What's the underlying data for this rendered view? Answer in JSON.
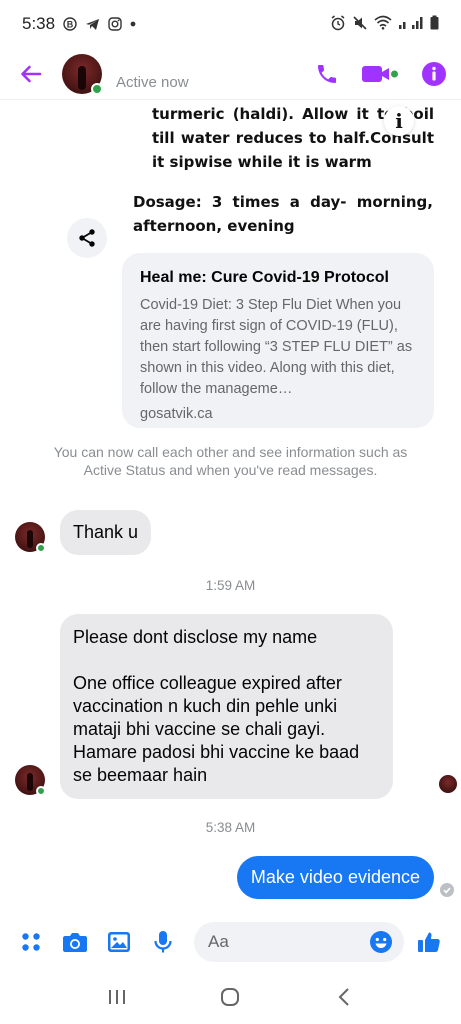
{
  "status_bar": {
    "time": "5:38",
    "left_icons": [
      "b-circle-icon",
      "telegram-icon",
      "instagram-icon",
      "dot-icon"
    ],
    "right_icons": [
      "alarm-icon",
      "mute-icon",
      "wifi-icon",
      "signal-icon",
      "battery-icon"
    ]
  },
  "header": {
    "status": "Active now",
    "accent_color": "#a033ff",
    "icons": [
      "back-arrow-icon",
      "phone-icon",
      "video-icon",
      "info-icon"
    ]
  },
  "thread": {
    "forwarded_text": "turmeric (haldi). Allow it to boil till water reduces to half.Consult it sipwise while it is warm",
    "dosage_text": "Dosage: 3 times a day- morning, afternoon, evening",
    "link_card": {
      "title": "Heal me: Cure Covid-19 Protocol",
      "description": "Covid-19 Diet: 3 Step Flu Diet When you are having first sign of COVID-19 (FLU), then start following “3 STEP FLU DIET” as shown in this video. Along with this diet, follow the manageme…",
      "domain": "gosatvik.ca"
    },
    "system_note": "You can now call each other and see information such as Active Status and when you've read messages.",
    "messages": [
      {
        "direction": "in",
        "text": "Thank u"
      },
      {
        "direction": "timestamp",
        "text": "1:59 AM"
      },
      {
        "direction": "in",
        "text_line1": "Please dont disclose my name",
        "text_line2": "One office colleague expired after vaccination n kuch din pehle unki mataji bhi vaccine se chali gayi. Hamare padosi bhi vaccine ke baad se beemaar hain"
      },
      {
        "direction": "timestamp",
        "text": "5:38 AM"
      },
      {
        "direction": "out",
        "text": "Make video evidence"
      }
    ]
  },
  "composer": {
    "placeholder": "Aa",
    "icons": [
      "apps-icon",
      "camera-icon",
      "gallery-icon",
      "mic-icon",
      "emoji-icon",
      "thumbs-up-icon"
    ],
    "blue": "#1877f2"
  },
  "nav": {
    "icons": [
      "recents-icon",
      "home-icon",
      "back-icon"
    ]
  }
}
